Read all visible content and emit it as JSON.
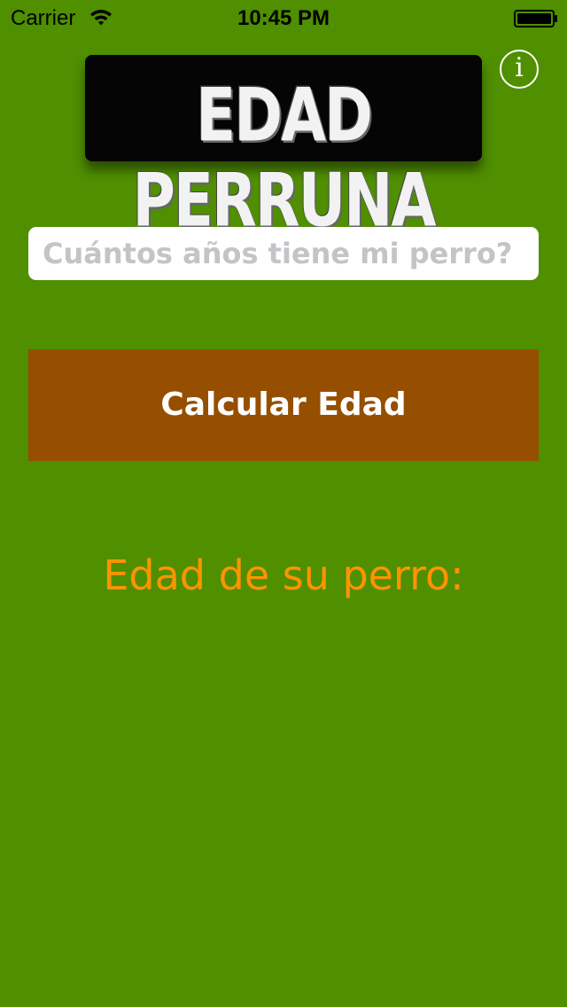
{
  "status_bar": {
    "carrier": "Carrier",
    "time": "10:45 PM",
    "wifi_icon": "wifi-icon",
    "battery_icon": "battery-icon"
  },
  "header": {
    "logo_text": "EDAD PERRUNA",
    "info_label": "i",
    "info_icon": "info-icon"
  },
  "form": {
    "age_input_placeholder": "Cuántos años tiene mi perro?",
    "age_input_value": "",
    "calculate_label": "Calcular Edad"
  },
  "result": {
    "label": "Edad de su perro:"
  },
  "colors": {
    "background": "#4f8f00",
    "button": "#964f00",
    "result_text": "#ff9300",
    "placeholder": "#c3c3c8"
  }
}
